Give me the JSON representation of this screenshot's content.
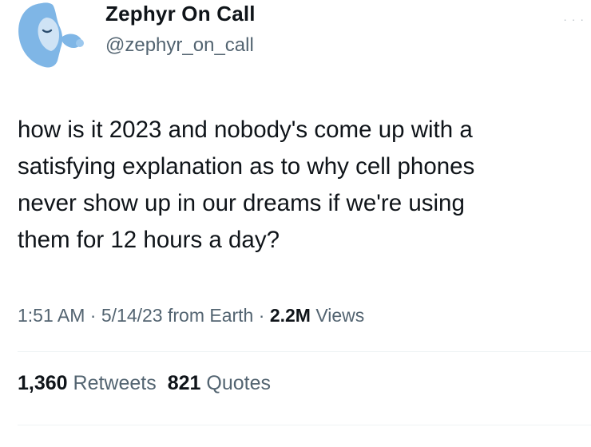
{
  "user": {
    "display_name": "Zephyr On Call",
    "handle": "@zephyr_on_call",
    "avatar_icon": "cartoon-face-avatar-icon"
  },
  "more_icon": "more-options-icon",
  "tweet": {
    "text": "how is it 2023 and nobody's come up with a\nsatisfying explanation as to why cell phones\nnever show up in our dreams if we're using\nthem for 12 hours a day?"
  },
  "meta": {
    "time": "1:51 AM",
    "separator1": " · ",
    "date": "5/14/23",
    "source": " from Earth",
    "separator2": " · ",
    "views_count": "2.2M",
    "views_label": " Views"
  },
  "stats": {
    "retweets_count": "1,360",
    "retweets_label": " Retweets",
    "quotes_count": "821",
    "quotes_label": " Quotes"
  },
  "colors": {
    "text_primary": "#0f1419",
    "text_secondary": "#536471",
    "avatar_blue": "#7fb6e6",
    "divider": "#eff3f4"
  }
}
